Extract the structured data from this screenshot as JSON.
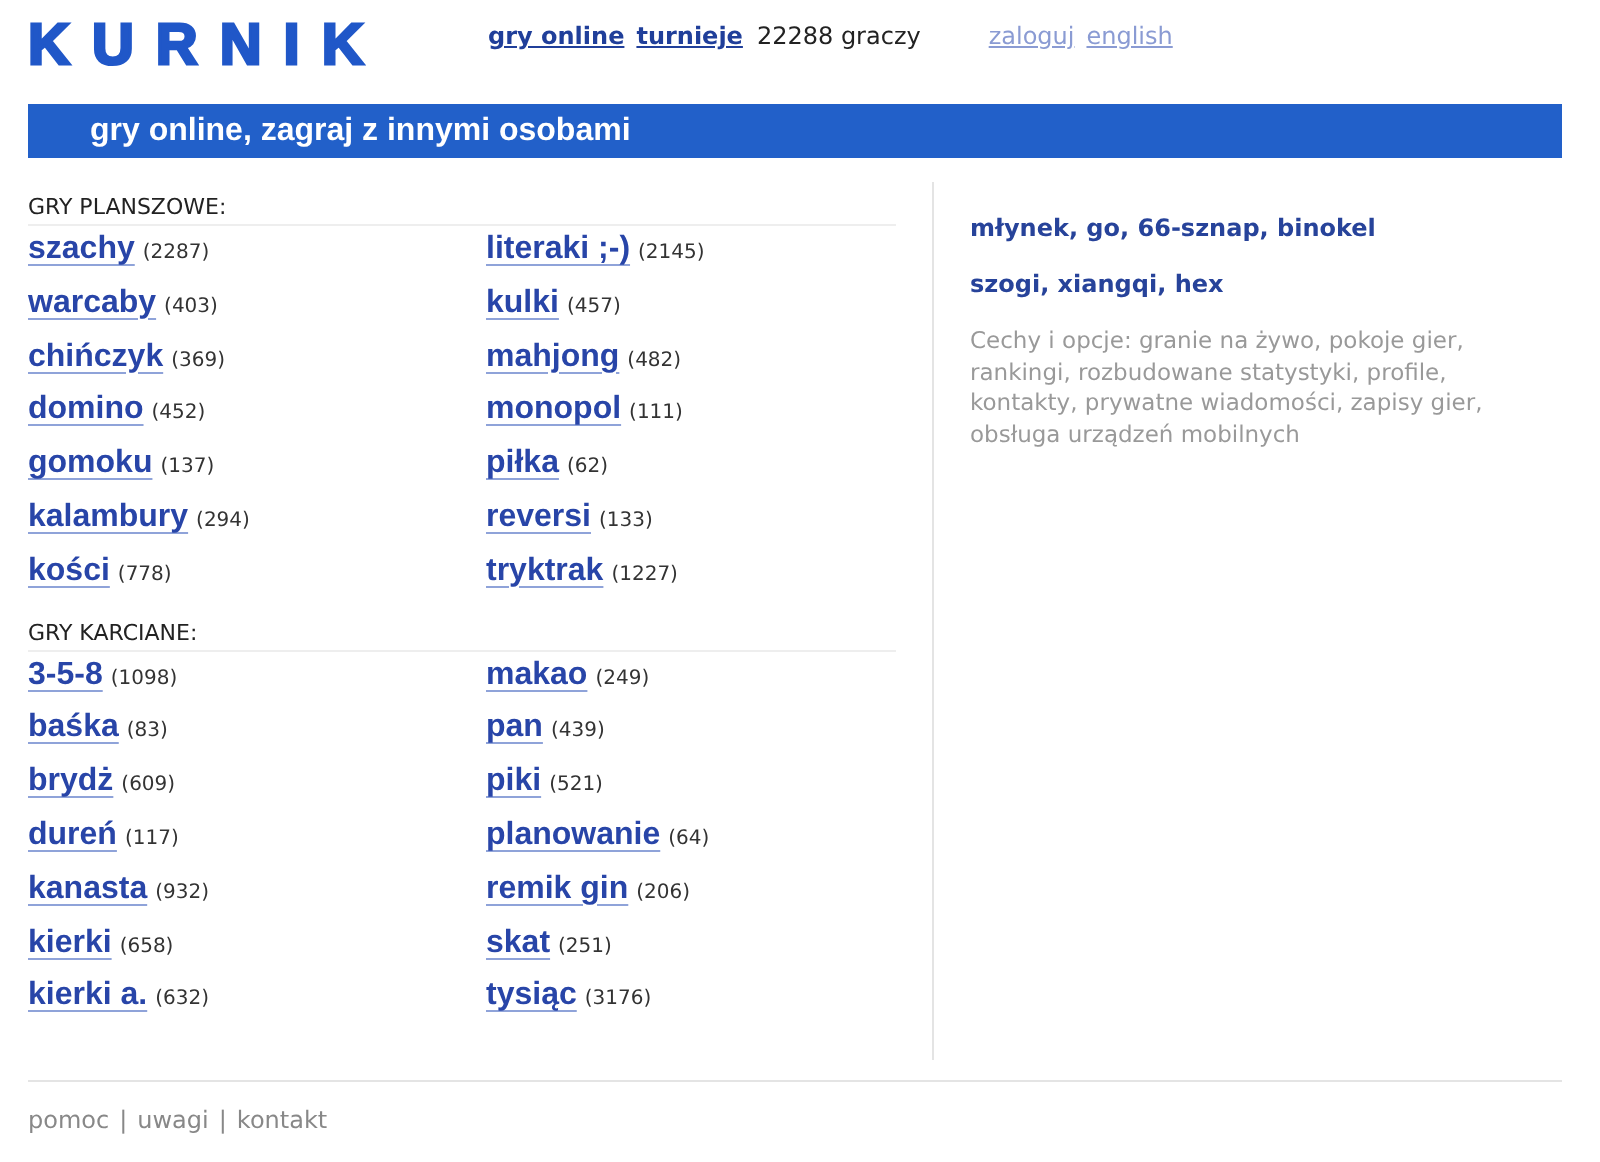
{
  "logo": "KURNIK",
  "top_nav": [
    {
      "label": "gry online",
      "kind": "main"
    },
    {
      "label": "turnieje",
      "kind": "main"
    }
  ],
  "player_count": "22288 graczy",
  "account_links": [
    {
      "label": "zaloguj"
    },
    {
      "label": "english"
    }
  ],
  "banner": "gry online, zagraj z innymi osobami",
  "sections": [
    {
      "title": "GRY PLANSZOWE:",
      "games": [
        {
          "name": "szachy",
          "count": "(2287)"
        },
        {
          "name": "literaki ;-)",
          "count": "(2145)"
        },
        {
          "name": "warcaby",
          "count": "(403)"
        },
        {
          "name": "kulki",
          "count": "(457)"
        },
        {
          "name": "chińczyk",
          "count": "(369)"
        },
        {
          "name": "mahjong",
          "count": "(482)"
        },
        {
          "name": "domino",
          "count": "(452)"
        },
        {
          "name": "monopol",
          "count": "(111)"
        },
        {
          "name": "gomoku",
          "count": "(137)"
        },
        {
          "name": "piłka",
          "count": "(62)"
        },
        {
          "name": "kalambury",
          "count": "(294)"
        },
        {
          "name": "reversi",
          "count": "(133)"
        },
        {
          "name": "kości",
          "count": "(778)"
        },
        {
          "name": "tryktrak",
          "count": "(1227)"
        }
      ]
    },
    {
      "title": "GRY KARCIANE:",
      "games": [
        {
          "name": "3-5-8",
          "count": "(1098)"
        },
        {
          "name": "makao",
          "count": "(249)"
        },
        {
          "name": "baśka",
          "count": "(83)"
        },
        {
          "name": "pan",
          "count": "(439)"
        },
        {
          "name": "brydż",
          "count": "(609)"
        },
        {
          "name": "piki",
          "count": "(521)"
        },
        {
          "name": "dureń",
          "count": "(117)"
        },
        {
          "name": "planowanie",
          "count": "(64)"
        },
        {
          "name": "kanasta",
          "count": "(932)"
        },
        {
          "name": "remik gin",
          "count": "(206)"
        },
        {
          "name": "kierki",
          "count": "(658)"
        },
        {
          "name": "skat",
          "count": "(251)"
        },
        {
          "name": "kierki a.",
          "count": "(632)"
        },
        {
          "name": "tysiąc",
          "count": "(3176)"
        }
      ]
    }
  ],
  "more_games": [
    "młynek, go, 66-sznap, binokel",
    "szogi, xiangqi, hex"
  ],
  "features": "Cechy i opcje: granie na żywo, pokoje gier, rankingi, rozbudowane statystyki, profile, kontakty, prywatne wiadomości, zapisy gier, obsługa urządzeń mobilnych",
  "footer": {
    "links": [
      "pomoc",
      "uwagi",
      "kontakt"
    ],
    "separator": "|"
  }
}
